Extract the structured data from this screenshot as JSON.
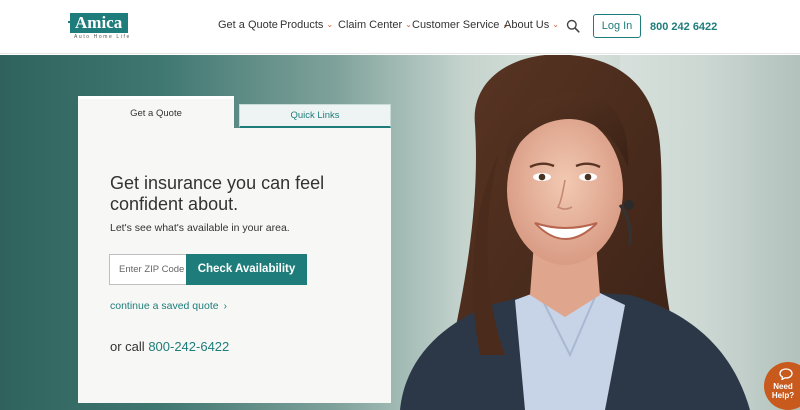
{
  "header": {
    "logo": {
      "word": "Amica",
      "tagline": "Auto  Home  Life"
    },
    "nav": [
      {
        "label": "Get a Quote"
      },
      {
        "label": "Products"
      },
      {
        "label": "Claim Center"
      },
      {
        "label": "Customer Service"
      },
      {
        "label": "About Us"
      }
    ],
    "login_label": "Log In",
    "phone": "800 242 6422"
  },
  "card": {
    "tabs": [
      {
        "label": "Get a Quote"
      },
      {
        "label": "Quick Links"
      }
    ],
    "headline": "Get insurance you can feel confident about.",
    "subtext": "Let's see what's available in your area.",
    "zip_placeholder": "Enter ZIP Code",
    "zip_value": "",
    "check_label": "Check Availability",
    "saved_quote_label": "continue a saved quote",
    "call_prefix": "or call",
    "call_number": "800-242-6422"
  },
  "help": {
    "label": "Need Help?"
  },
  "colors": {
    "brand": "#1e7d7a",
    "accent": "#d9622b",
    "help": "#c85a1d"
  },
  "icons": [
    "search-icon",
    "chevron-down-icon",
    "chevron-right-icon",
    "chat-bubble-icon"
  ]
}
